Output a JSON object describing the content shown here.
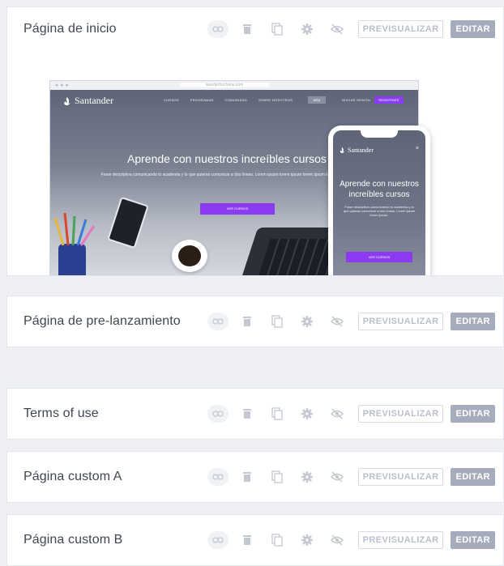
{
  "colors": {
    "background": "#edeff3",
    "card": "#ffffff",
    "accent_purple": "#8b3cf2",
    "edit_button": "#a6acbc",
    "icon_gray": "#c3c8d2"
  },
  "row_actions": {
    "icons": [
      "link-icon",
      "trash-icon",
      "duplicate-icon",
      "gear-icon",
      "hidden-eye-icon"
    ],
    "preview_label": "PREVISUALIZAR",
    "edit_label": "EDITAR"
  },
  "pages": [
    {
      "title": "Página de inicio",
      "expanded": true
    },
    {
      "title": "Página de pre-lanzamiento",
      "expanded": false
    },
    {
      "title": "Terms of use",
      "expanded": false
    },
    {
      "title": "Página custom A",
      "expanded": false
    },
    {
      "title": "Página custom B",
      "expanded": false
    }
  ],
  "preview": {
    "url": "launderforchime.com",
    "brand": "Santander",
    "nav_links": [
      "CURSOS",
      "PROGRAMAS",
      "COMUNIDAD",
      "SOBRE NOSOTROS"
    ],
    "nav_more": "MÁS",
    "nav_login": "INICIAR SESIÓN",
    "nav_register": "REGISTRATE",
    "hero_title": "Aprende con nuestros increíbles cursos",
    "hero_subtitle": "Frase descriptiva comunicando tu academia y lo que quieras comunicar a dos líneas. Lorem ipsum lorem ipsum lorem ipsum lorem ipsum lorem ipsum.",
    "hero_cta": "VER CURSOS",
    "mobile_title": "Aprende con nuestros increíbles cursos",
    "mobile_subtitle": "Frase descriptiva comunicando tu academia y lo que quieras comunicar a dos líneas. Lorem ipsum lorem ipsum.",
    "mobile_cta": "VER CURSOS"
  }
}
